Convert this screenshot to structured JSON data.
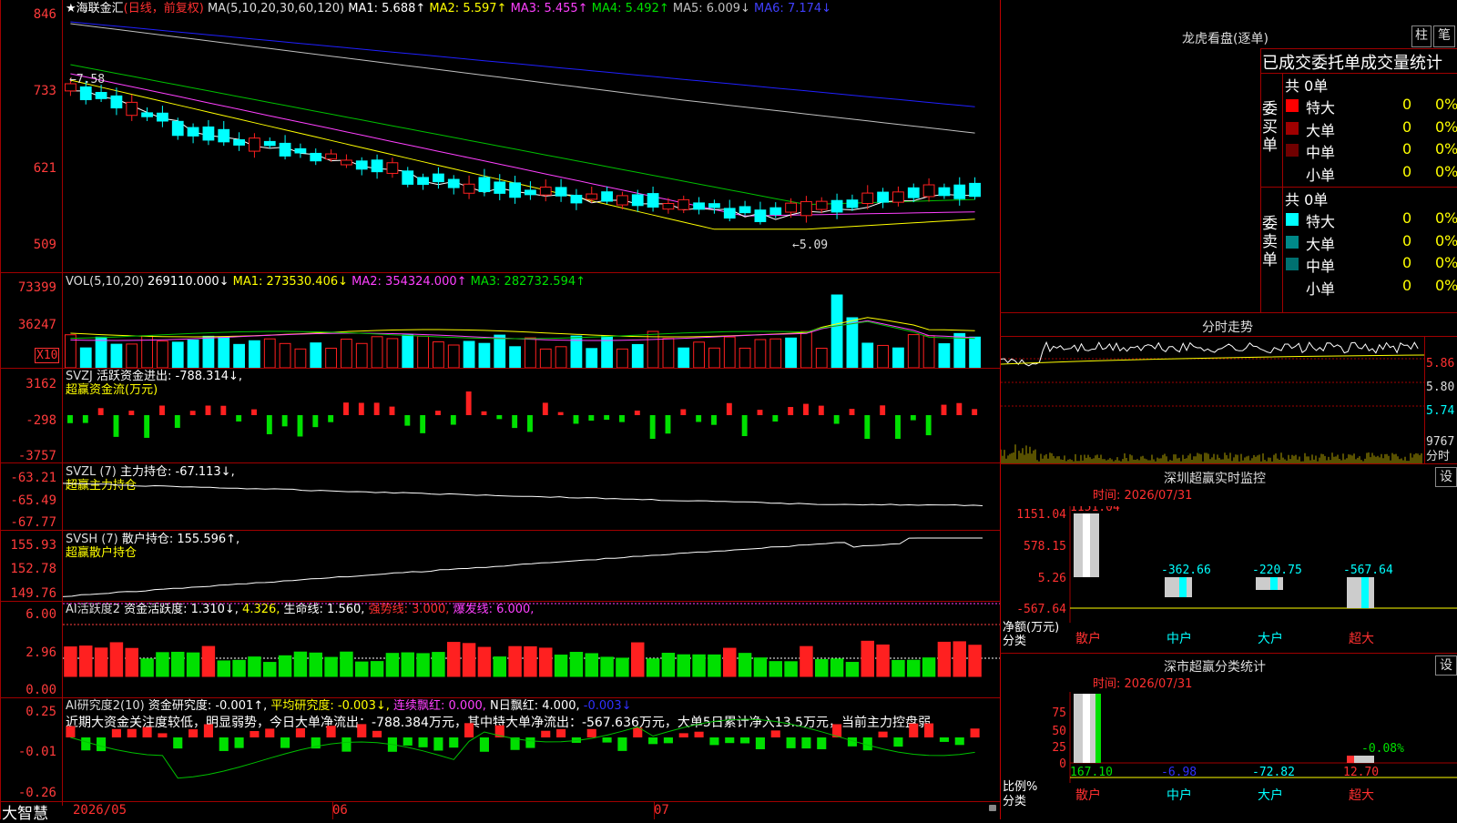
{
  "main_chart": {
    "header": {
      "title": "★海联金汇",
      "period": "(日线，前复权)",
      "ma_label": "MA(5,10,20,30,60,120)",
      "ma1": "MA1: 5.688↑",
      "ma2": "MA2: 5.597↑",
      "ma3": "MA3: 5.455↑",
      "ma4": "MA4: 5.492↑",
      "ma5": "MA5: 6.009↓",
      "ma6": "MA6: 7.174↓"
    },
    "y_ticks": [
      "846",
      "733",
      "621",
      "509"
    ],
    "annotation_high": "←7.58",
    "annotation_low": "←5.09",
    "colors": {
      "up": "#ff2020",
      "down": "#00ffff",
      "ma1": "#ffffff",
      "ma2": "#ffff00",
      "ma3": "#ff40ff",
      "ma4": "#00c000",
      "ma5": "#c0c0c0",
      "ma6": "#2020ff"
    }
  },
  "volume": {
    "header": {
      "name": "VOL(5,10,20)",
      "value": "269110.000↓",
      "ma1": "MA1: 273530.406↓",
      "ma2": "MA2: 354324.000↑",
      "ma3": "MA3: 282732.594↑"
    },
    "y_ticks": [
      "73399",
      "36247"
    ],
    "unit": "X10"
  },
  "svzj": {
    "header": {
      "name": "SVZJ",
      "value": "活跃资金进出: -788.314↓,",
      "sub": "超赢资金流(万元)"
    },
    "y_ticks": [
      "3162",
      "-298",
      "-3757"
    ]
  },
  "svzl": {
    "header": {
      "name": "SVZL (7)",
      "value": "主力持仓: -67.113↓,",
      "sub": "超赢主力持仓"
    },
    "y_ticks": [
      "-63.21",
      "-65.49",
      "-67.77"
    ]
  },
  "svsh": {
    "header": {
      "name": "SVSH (7)",
      "value": "散户持仓: 155.596↑,",
      "sub": "超赢散户持仓"
    },
    "y_ticks": [
      "155.93",
      "152.78",
      "149.76"
    ]
  },
  "ai_active": {
    "header": {
      "name": "AI活跃度2",
      "v1": "资金活跃度: 1.310↓,",
      "v2": "4.326,",
      "v3": "生命线: 1.560,",
      "v4": "强势线: 3.000,",
      "v5": "爆发线: 6.000,"
    },
    "y_ticks": [
      "6.00",
      "2.96",
      "0.00"
    ]
  },
  "ai_research": {
    "header": {
      "name": "AI研究度2(10)",
      "v1": "资金研究度: -0.001↑,",
      "v2": "平均研究度: -0.003↓,",
      "v3": "连续飘红: 0.000,",
      "v4": "N日飘红: 4.000,",
      "v5": "-0.003↓"
    },
    "comment": "近期大资金关注度较低，明显弱势，今日大单净流出：-788.384万元，其中特大单净流出：-567.636万元，大单5日累计净入13.5万元，当前主力控盘弱",
    "y_ticks": [
      "0.25",
      "-0.01",
      "-0.26"
    ]
  },
  "bottom_bar": {
    "brand": "大智慧",
    "dates": [
      "2026/05",
      "06",
      "07"
    ]
  },
  "right_panel": {
    "longhu": {
      "title": "龙虎看盘(逐单)",
      "btn1": "柱",
      "btn2": "笔",
      "subtitle": "已成交委托单成交量统计",
      "buy_label": "委买单",
      "sell_label": "委卖单",
      "buy_total": "共 0单",
      "sell_total": "共 0单",
      "buy_rows": [
        {
          "name": "特大",
          "count": "0",
          "pct": "0%",
          "color": "#ff0000"
        },
        {
          "name": "大单",
          "count": "0",
          "pct": "0%",
          "color": "#a00000"
        },
        {
          "name": "中单",
          "count": "0",
          "pct": "0%",
          "color": "#700000"
        },
        {
          "name": "小单",
          "count": "0",
          "pct": "0%",
          "color": "#000000"
        }
      ],
      "sell_rows": [
        {
          "name": "特大",
          "count": "0",
          "pct": "0%",
          "color": "#00ffff"
        },
        {
          "name": "大单",
          "count": "0",
          "pct": "0%",
          "color": "#008888"
        },
        {
          "name": "中单",
          "count": "0",
          "pct": "0%",
          "color": "#007070"
        },
        {
          "name": "小单",
          "count": "0",
          "pct": "0%",
          "color": "#000000"
        }
      ]
    },
    "intraday": {
      "title": "分时走势",
      "price_ticks": [
        "5.86",
        "5.80",
        "5.74"
      ],
      "vol_tick": "9767",
      "vol_label": "分时"
    },
    "sz_monitor": {
      "title": "深圳超赢实时监控",
      "btn": "设",
      "time": "时间: 2026/07/31",
      "y_ticks": [
        "1151.04",
        "578.15",
        "5.26",
        "-567.64"
      ],
      "top_value": "1151.04",
      "values": [
        "-362.66",
        "-220.75",
        "-567.64"
      ],
      "y_label": "净额(万元)",
      "x_label": "分类",
      "categories": [
        "散户",
        "中户",
        "大户",
        "超大"
      ]
    },
    "sz_class": {
      "title": "深市超赢分类统计",
      "btn": "设",
      "time": "时间: 2026/07/31",
      "y_ticks": [
        "75",
        "50",
        "25",
        "0"
      ],
      "value_top": "-0.08%",
      "values": [
        "167.10",
        "-6.98",
        "-72.82",
        "12.70"
      ],
      "y_label": "比例%",
      "x_label": "分类",
      "categories": [
        "散户",
        "中户",
        "大户",
        "超大"
      ]
    }
  }
}
